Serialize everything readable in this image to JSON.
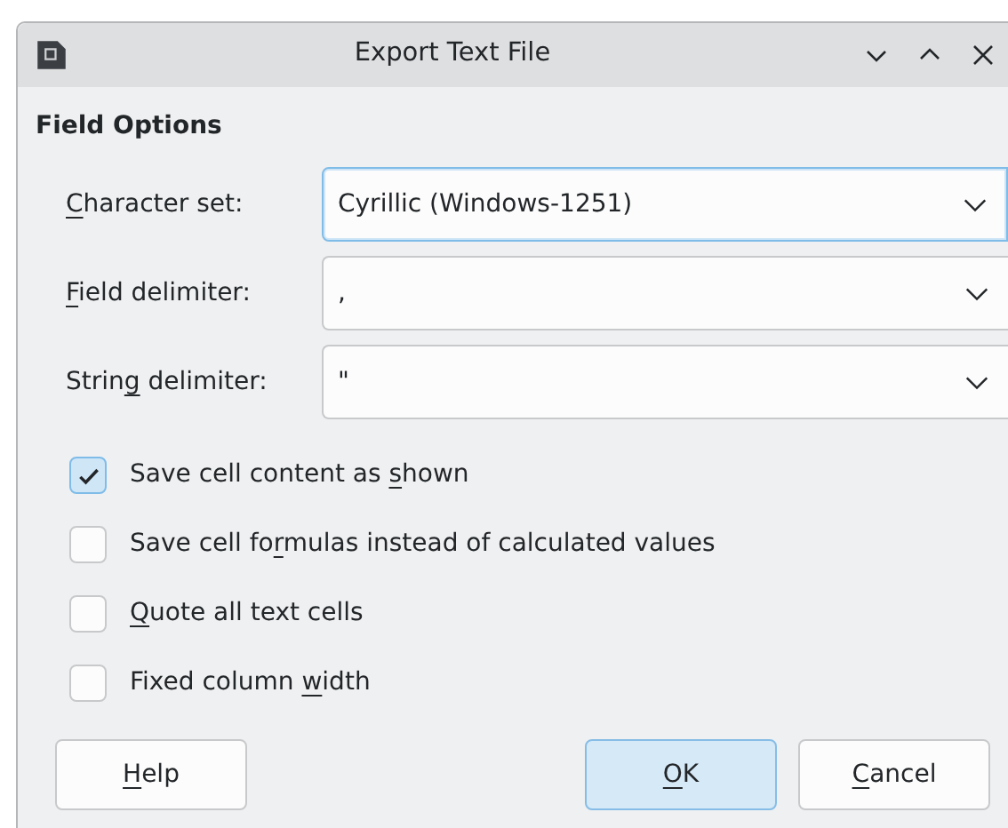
{
  "window": {
    "title": "Export Text File"
  },
  "section_title": "Field Options",
  "fields": [
    {
      "label": {
        "key": "C",
        "after": "haracter set:"
      },
      "value": "Cyrillic (Windows-1251)",
      "focused": true
    },
    {
      "label": {
        "key": "F",
        "after": "ield delimiter:"
      },
      "value": ",",
      "focused": false
    },
    {
      "label": {
        "before": "Strin",
        "key": "g",
        "after": " delimiter:"
      },
      "value": "\"",
      "focused": false
    }
  ],
  "options": [
    {
      "label": {
        "before": "Save cell content as ",
        "key": "s",
        "after": "hown"
      },
      "checked": true
    },
    {
      "label": {
        "before": "Save cell fo",
        "key": "r",
        "after": "mulas instead of calculated values"
      },
      "checked": false
    },
    {
      "label": {
        "key": "Q",
        "after": "uote all text cells"
      },
      "checked": false
    },
    {
      "label": {
        "before": "Fixed column ",
        "key": "w",
        "after": "idth"
      },
      "checked": false
    }
  ],
  "buttons": [
    {
      "label": {
        "key": "H",
        "after": "elp"
      },
      "default": false
    },
    {
      "label": {
        "key": "O",
        "after": "K"
      },
      "default": true
    },
    {
      "label": {
        "key": "C",
        "after": "ancel"
      },
      "default": false
    }
  ]
}
